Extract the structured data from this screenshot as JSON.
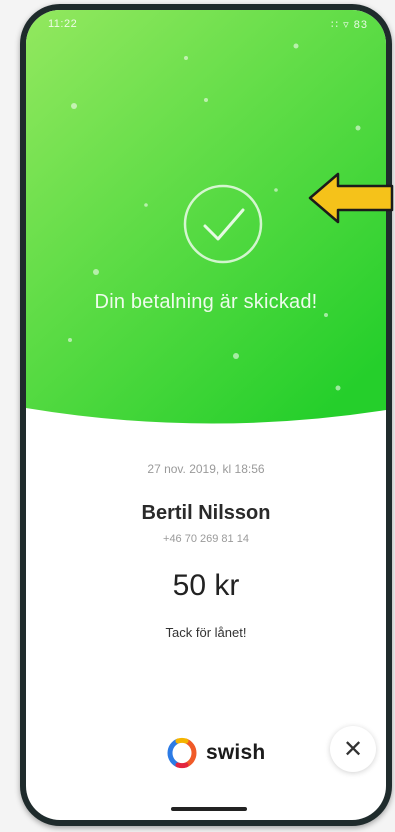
{
  "status_bar": {
    "time": "11:22",
    "right": "∷ ▿ 83"
  },
  "hero": {
    "confirmation_text": "Din betalning är skickad!",
    "gradient_start": "#8ee65a",
    "gradient_end": "#27d02c"
  },
  "payment": {
    "datetime": "27 nov. 2019, kl 18:56",
    "recipient_name": "Bertil Nilsson",
    "recipient_phone": "+46 70 269 81 14",
    "amount": "50 kr",
    "message": "Tack för lånet!"
  },
  "footer": {
    "brand": "swish",
    "close_symbol": "✕"
  },
  "annotation": {
    "arrow_color": "#f5c21a"
  }
}
